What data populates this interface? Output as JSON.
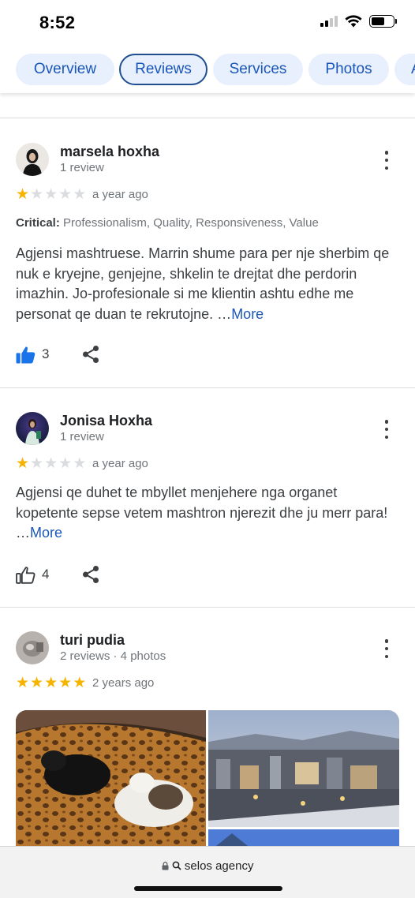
{
  "status": {
    "time": "8:52"
  },
  "tabs": [
    {
      "label": "Overview"
    },
    {
      "label": "Reviews"
    },
    {
      "label": "Services"
    },
    {
      "label": "Photos"
    },
    {
      "label": "A"
    }
  ],
  "reviews": [
    {
      "author": "marsela hoxha",
      "meta": "1 review",
      "rating": 1,
      "date": "a year ago",
      "critical_label": "Critical:",
      "critical_text": "Professionalism, Quality, Responsiveness, Value",
      "text": "Agjensi mashtruese. Marrin shume para per nje sherbim qe nuk e kryejne, genjejne, shkelin te drejtat dhe perdorin imazhin. Jo-profesionale si me klientin ashtu edhe me personat qe duan te rekrutojne. …",
      "more": "More",
      "likes": "3",
      "liked": true
    },
    {
      "author": "Jonisa Hoxha",
      "meta": "1 review",
      "rating": 1,
      "date": "a year ago",
      "text": "Agjensi qe duhet te mbyllet menjehere nga organet kopetente sepse vetem mashtron njerezit dhe ju merr para! …",
      "more": "More",
      "likes": "4",
      "liked": false
    },
    {
      "author": "turi pudia",
      "meta": "2 reviews · 4 photos",
      "rating": 5,
      "date": "2 years ago"
    }
  ],
  "bottom": {
    "url": "selos agency"
  },
  "colors": {
    "accent": "#1a56b8",
    "star": "#f6b400",
    "tab_bg": "#e8f0fe"
  },
  "icons": [
    "signal-icon",
    "wifi-icon",
    "battery-icon",
    "more-vert-icon",
    "thumb-up-icon",
    "share-icon",
    "lock-icon",
    "search-icon"
  ]
}
